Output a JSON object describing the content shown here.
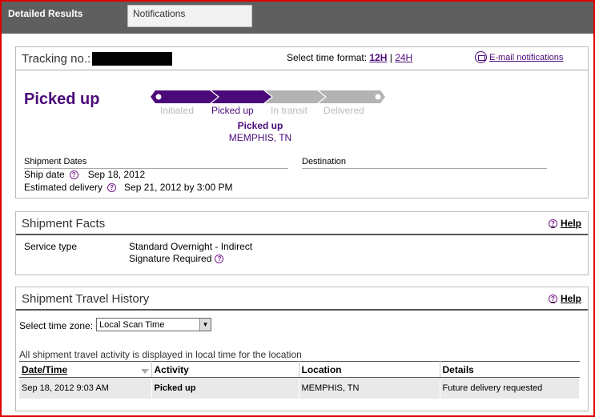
{
  "tabs": {
    "active": "Detailed Results",
    "inactive": "Notifications"
  },
  "tracking": {
    "label": "Tracking no.:",
    "time_format_label": "Select time format:",
    "format_12h": "12H",
    "format_sep": "|",
    "format_24h": "24H",
    "email_link": "E-mail notifications",
    "status_big": "Picked up",
    "stages": [
      "Initiated",
      "Picked up",
      "In transit",
      "Delivered"
    ],
    "current_status": "Picked up",
    "current_location": "MEMPHIS, TN",
    "ship_dates_header": "Shipment Dates",
    "destination_header": "Destination",
    "ship_date_label": "Ship date",
    "ship_date_value": "Sep 18, 2012",
    "est_delivery_label": "Estimated delivery",
    "est_delivery_value": "Sep 21, 2012 by 3:00 PM",
    "accent_color": "#4b0a7a"
  },
  "facts": {
    "title": "Shipment Facts",
    "help": "Help",
    "service_label": "Service type",
    "service_value": "Standard Overnight - Indirect",
    "signature": "Signature Required"
  },
  "history": {
    "title": "Shipment Travel History",
    "help": "Help",
    "tz_label": "Select time zone:",
    "tz_value": "Local Scan Time",
    "note": "All shipment travel activity is displayed in local time for the location",
    "columns": [
      "Date/Time",
      "Activity",
      "Location",
      "Details"
    ],
    "rows": [
      {
        "datetime": "Sep 18, 2012 9:03 AM",
        "activity": "Picked up",
        "location": "MEMPHIS, TN",
        "details": "Future delivery requested"
      }
    ]
  }
}
